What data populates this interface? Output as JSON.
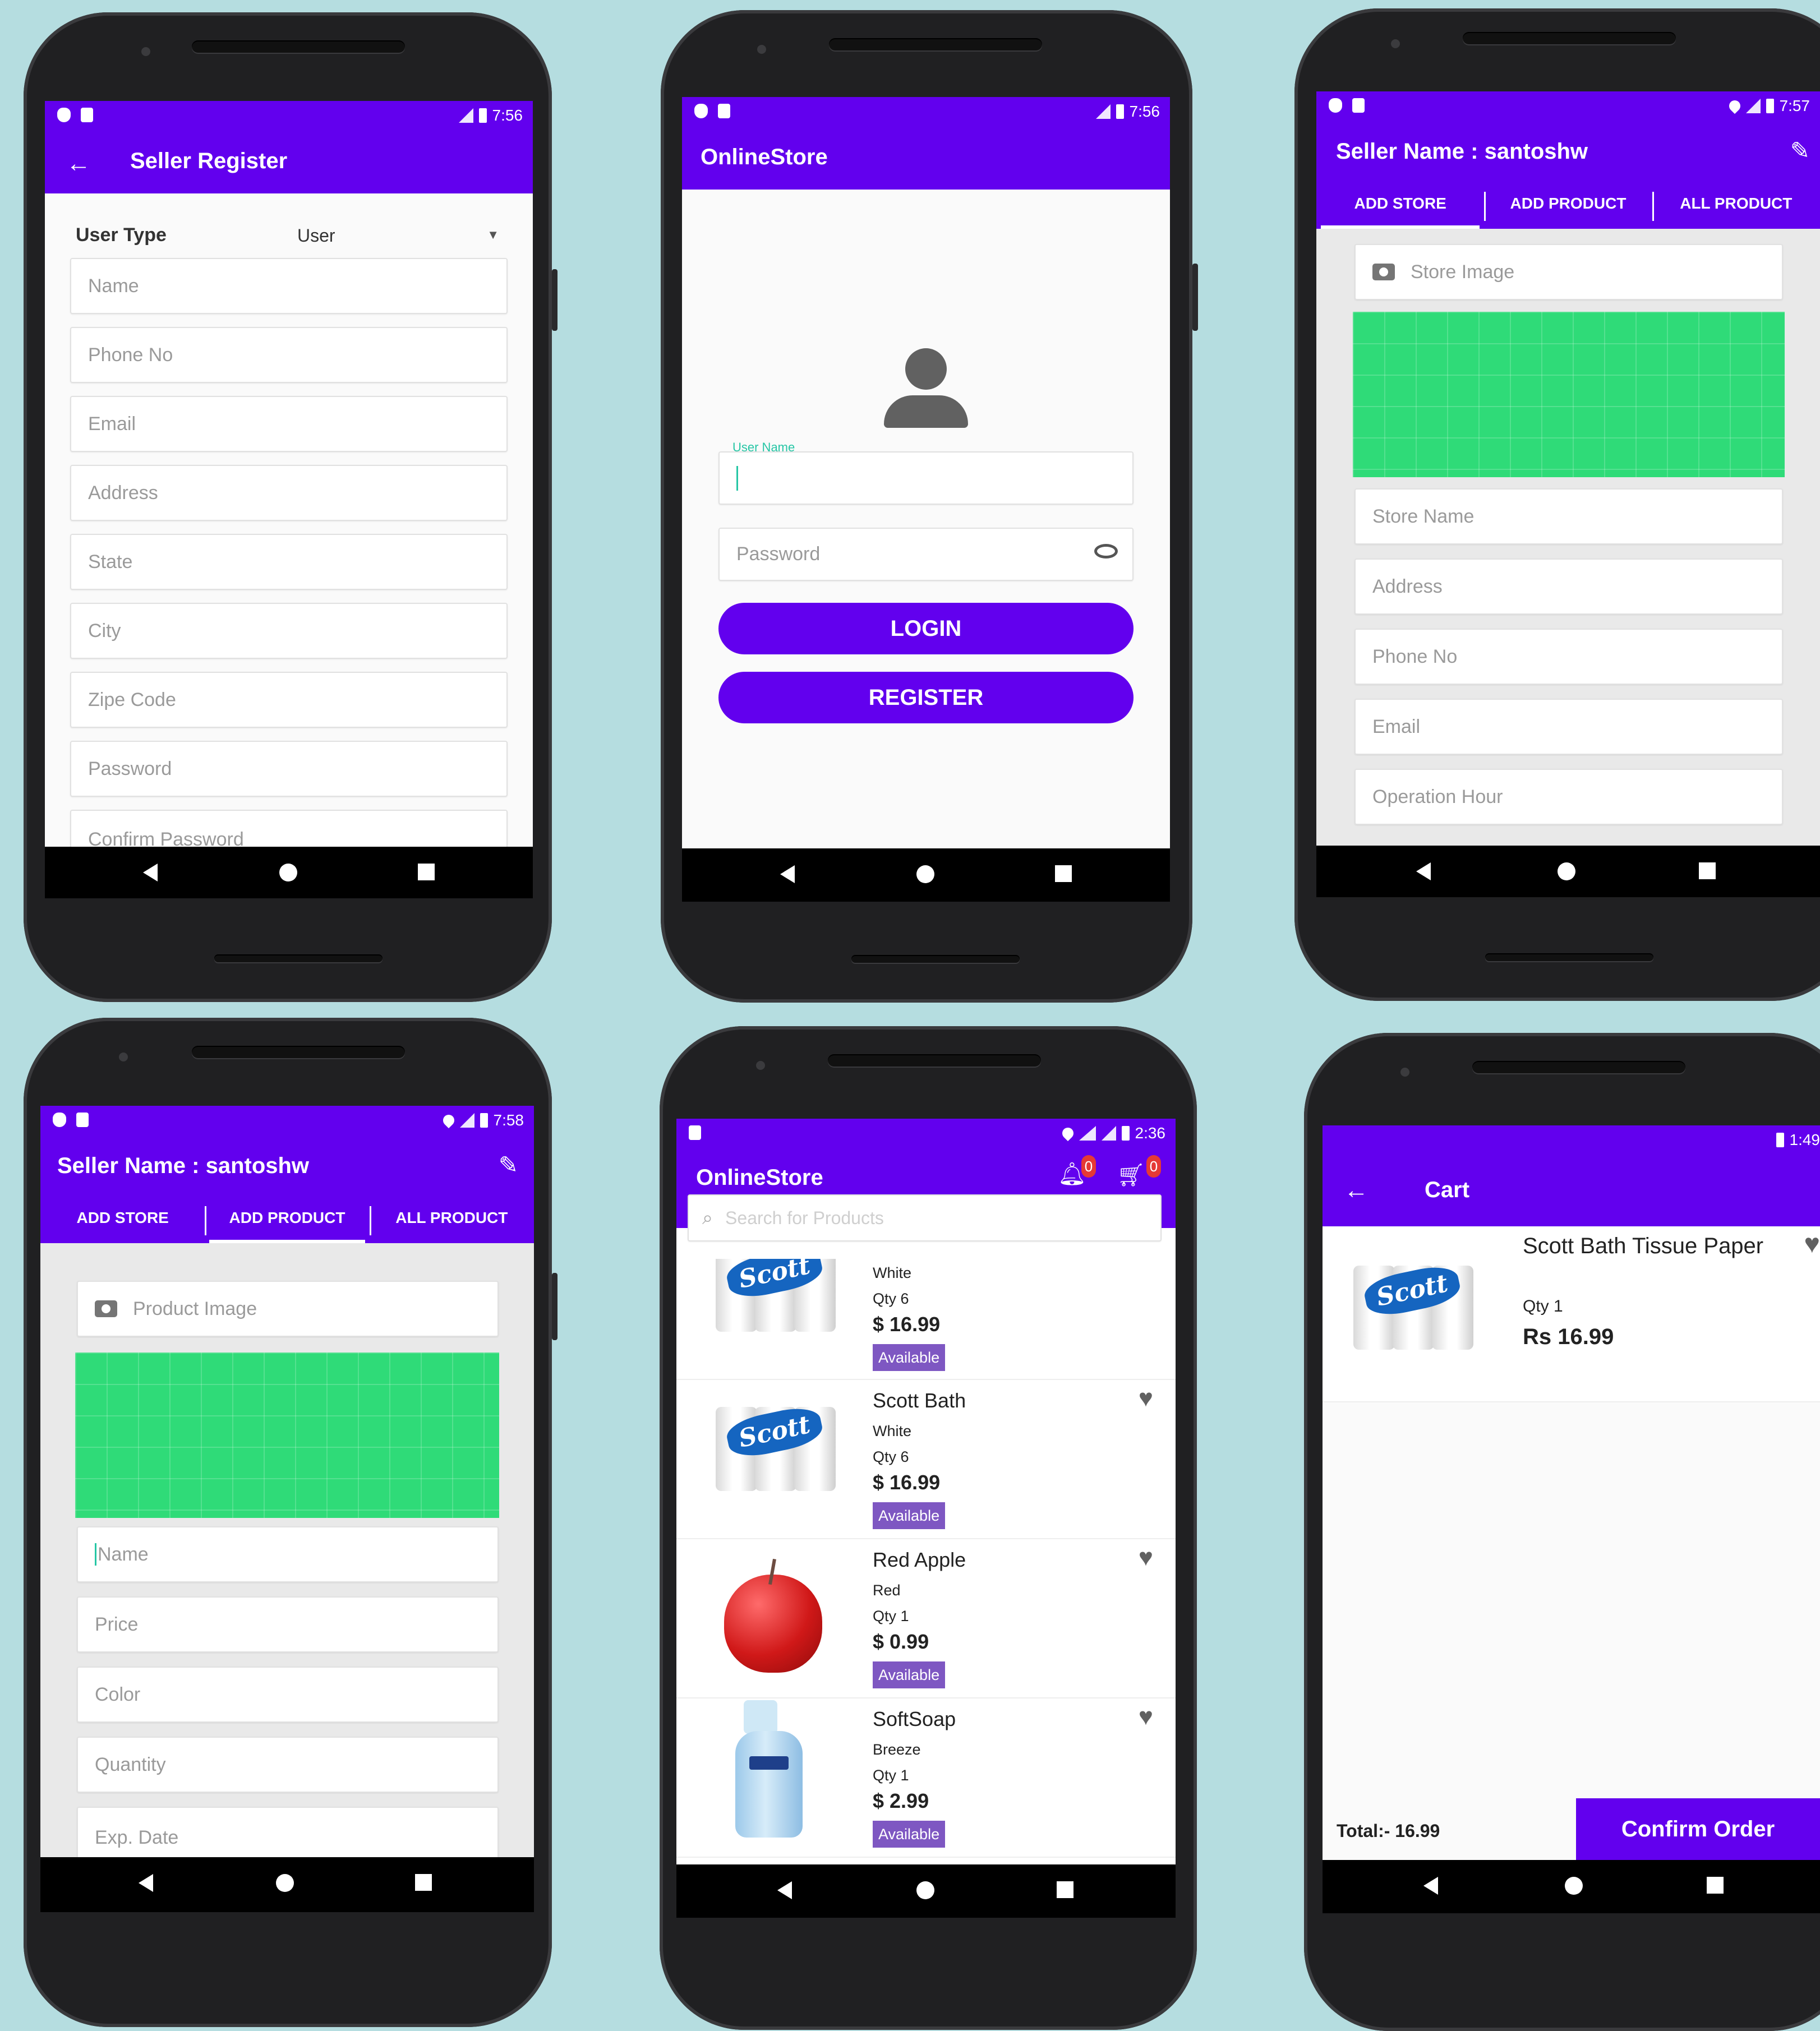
{
  "colors": {
    "primary": "#6200ee",
    "background": "#b5dde0",
    "green_placeholder": "#2fdb78",
    "available_badge": "#7e57c2"
  },
  "phone1": {
    "status_time": "7:56",
    "title": "Seller Register",
    "user_type_label": "User Type",
    "user_type_value": "User",
    "fields": [
      "Name",
      "Phone No",
      "Email",
      "Address",
      "State",
      "City",
      "Zipe Code",
      "Password",
      "Confirm Password"
    ]
  },
  "phone2": {
    "status_time": "7:56",
    "title": "OnlineStore",
    "username_label": "User Name",
    "password_placeholder": "Password",
    "login_label": "LOGIN",
    "register_label": "REGISTER"
  },
  "phone3": {
    "status_time": "7:57",
    "title": "Seller Name : santoshw",
    "tabs": [
      "ADD STORE",
      "ADD PRODUCT",
      "ALL PRODUCT"
    ],
    "image_field": "Store Image",
    "fields": [
      "Store Name",
      "Address",
      "Phone No",
      "Email",
      "Operation Hour"
    ]
  },
  "phone4": {
    "status_time": "7:58",
    "title": "Seller Name : santoshw",
    "tabs": [
      "ADD STORE",
      "ADD PRODUCT",
      "ALL PRODUCT"
    ],
    "image_field": "Product Image",
    "fields": [
      "Name",
      "Price",
      "Color",
      "Quantity",
      "Exp. Date"
    ]
  },
  "phone5": {
    "status_time": "2:36",
    "title": "OnlineStore",
    "notification_count": "0",
    "cart_count": "0",
    "search_placeholder": "Search for Products",
    "products": [
      {
        "name": "",
        "color": "White",
        "qty": "Qty 6",
        "price": "$ 16.99",
        "status": "Available"
      },
      {
        "name": "Scott Bath",
        "color": "White",
        "qty": "Qty 6",
        "price": "$ 16.99",
        "status": "Available"
      },
      {
        "name": "Red Apple",
        "color": "Red",
        "qty": "Qty 1",
        "price": "$ 0.99",
        "status": "Available"
      },
      {
        "name": "SoftSoap",
        "color": "Breeze",
        "qty": "Qty 1",
        "price": "$ 2.99",
        "status": "Available"
      }
    ],
    "brand_scott": "Scott"
  },
  "phone6": {
    "status_time": "1:49",
    "title": "Cart",
    "item_name": "Scott Bath Tissue Paper",
    "item_qty": "Qty 1",
    "item_price": "Rs 16.99",
    "total": "Total:- 16.99",
    "confirm_label": "Confirm Order",
    "brand_scott": "Scott"
  }
}
